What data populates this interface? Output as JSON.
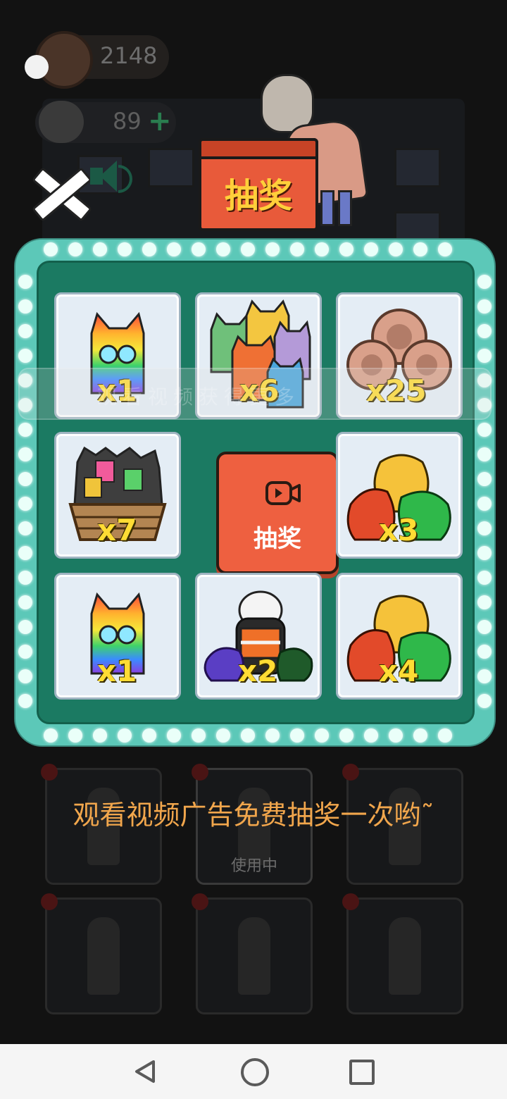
{
  "hud": {
    "coins": "2148",
    "cats": "89"
  },
  "draw_box_label": "抽奖",
  "grid": {
    "center_label": "抽奖",
    "overlay_text": "观看视频获得更多",
    "cells": [
      {
        "item": "rainbow-cat",
        "qty": "x1"
      },
      {
        "item": "cat-group",
        "qty": "x6"
      },
      {
        "item": "coins",
        "qty": "x25"
      },
      {
        "item": "cat-basket",
        "qty": "x7"
      },
      {
        "item": "treasure-bags",
        "qty": "x3"
      },
      {
        "item": "rainbow-cat",
        "qty": "x1"
      },
      {
        "item": "panda-with-bags",
        "qty": "x2"
      },
      {
        "item": "treasure-bags",
        "qty": "x4"
      }
    ]
  },
  "ad_text": "观看视频广告免费抽奖一次哟˜",
  "background_card_caption": "使用中",
  "colors": {
    "panel_outer": "#5cc8b8",
    "panel_inner": "#1b7a62",
    "center_button": "#ee6040",
    "qty_text": "#ffdc34",
    "ad_text": "#f1a64c"
  }
}
